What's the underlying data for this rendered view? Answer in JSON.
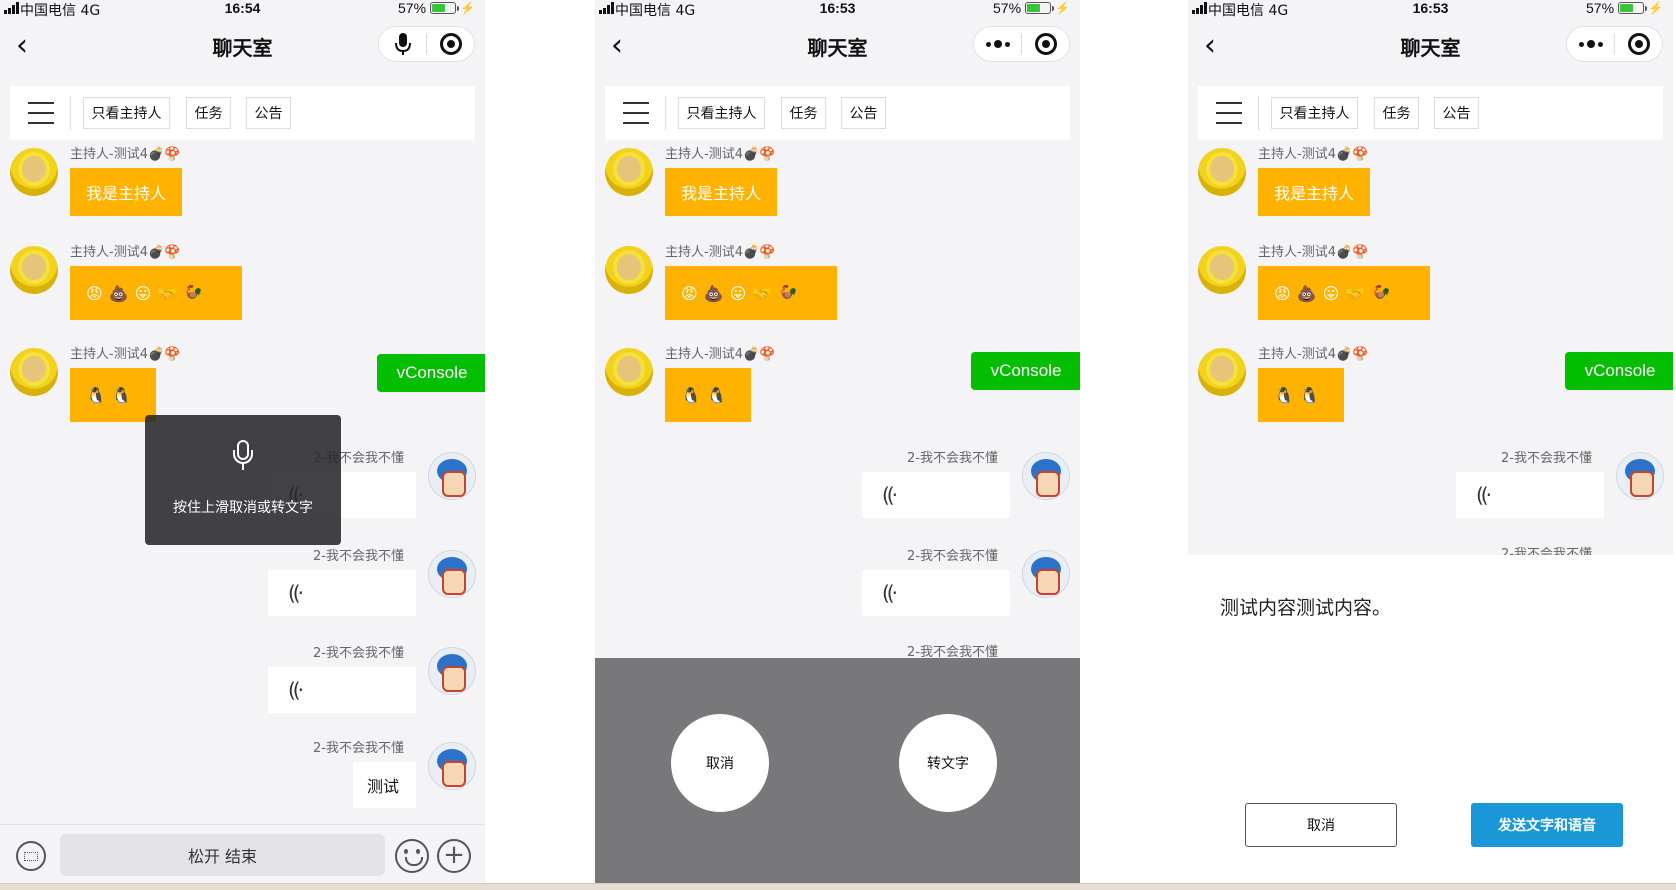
{
  "status": {
    "carrier": "中国电信  4G",
    "battery": "57%",
    "times": [
      "16:54",
      "16:53",
      "16:53"
    ]
  },
  "nav": {
    "title": "聊天室",
    "back_icon": "chevron-left-icon"
  },
  "tabs": [
    "只看主持人",
    "任务",
    "公告"
  ],
  "host_name": "主持人-测试4💣🍄",
  "host_messages": [
    "我是主持人",
    "😡💩😛🤝🐓",
    "🐧🐧"
  ],
  "other_name": "2-我不会我不懂",
  "voice_glyph": "((·",
  "text_message": "测试",
  "vconsole": "vConsole",
  "screen1": {
    "tip": "按住上滑取消或转文字",
    "hold_button": "松开 结束"
  },
  "screen2": {
    "cancel": "取消",
    "to_text": "转文字"
  },
  "screen3": {
    "content": "测试内容测试内容。",
    "cancel": "取消",
    "send": "发送文字和语音"
  },
  "colors": {
    "accent_yellow": "#ffb300",
    "vconsole_green": "#04be02",
    "send_blue": "#1a97d6"
  }
}
